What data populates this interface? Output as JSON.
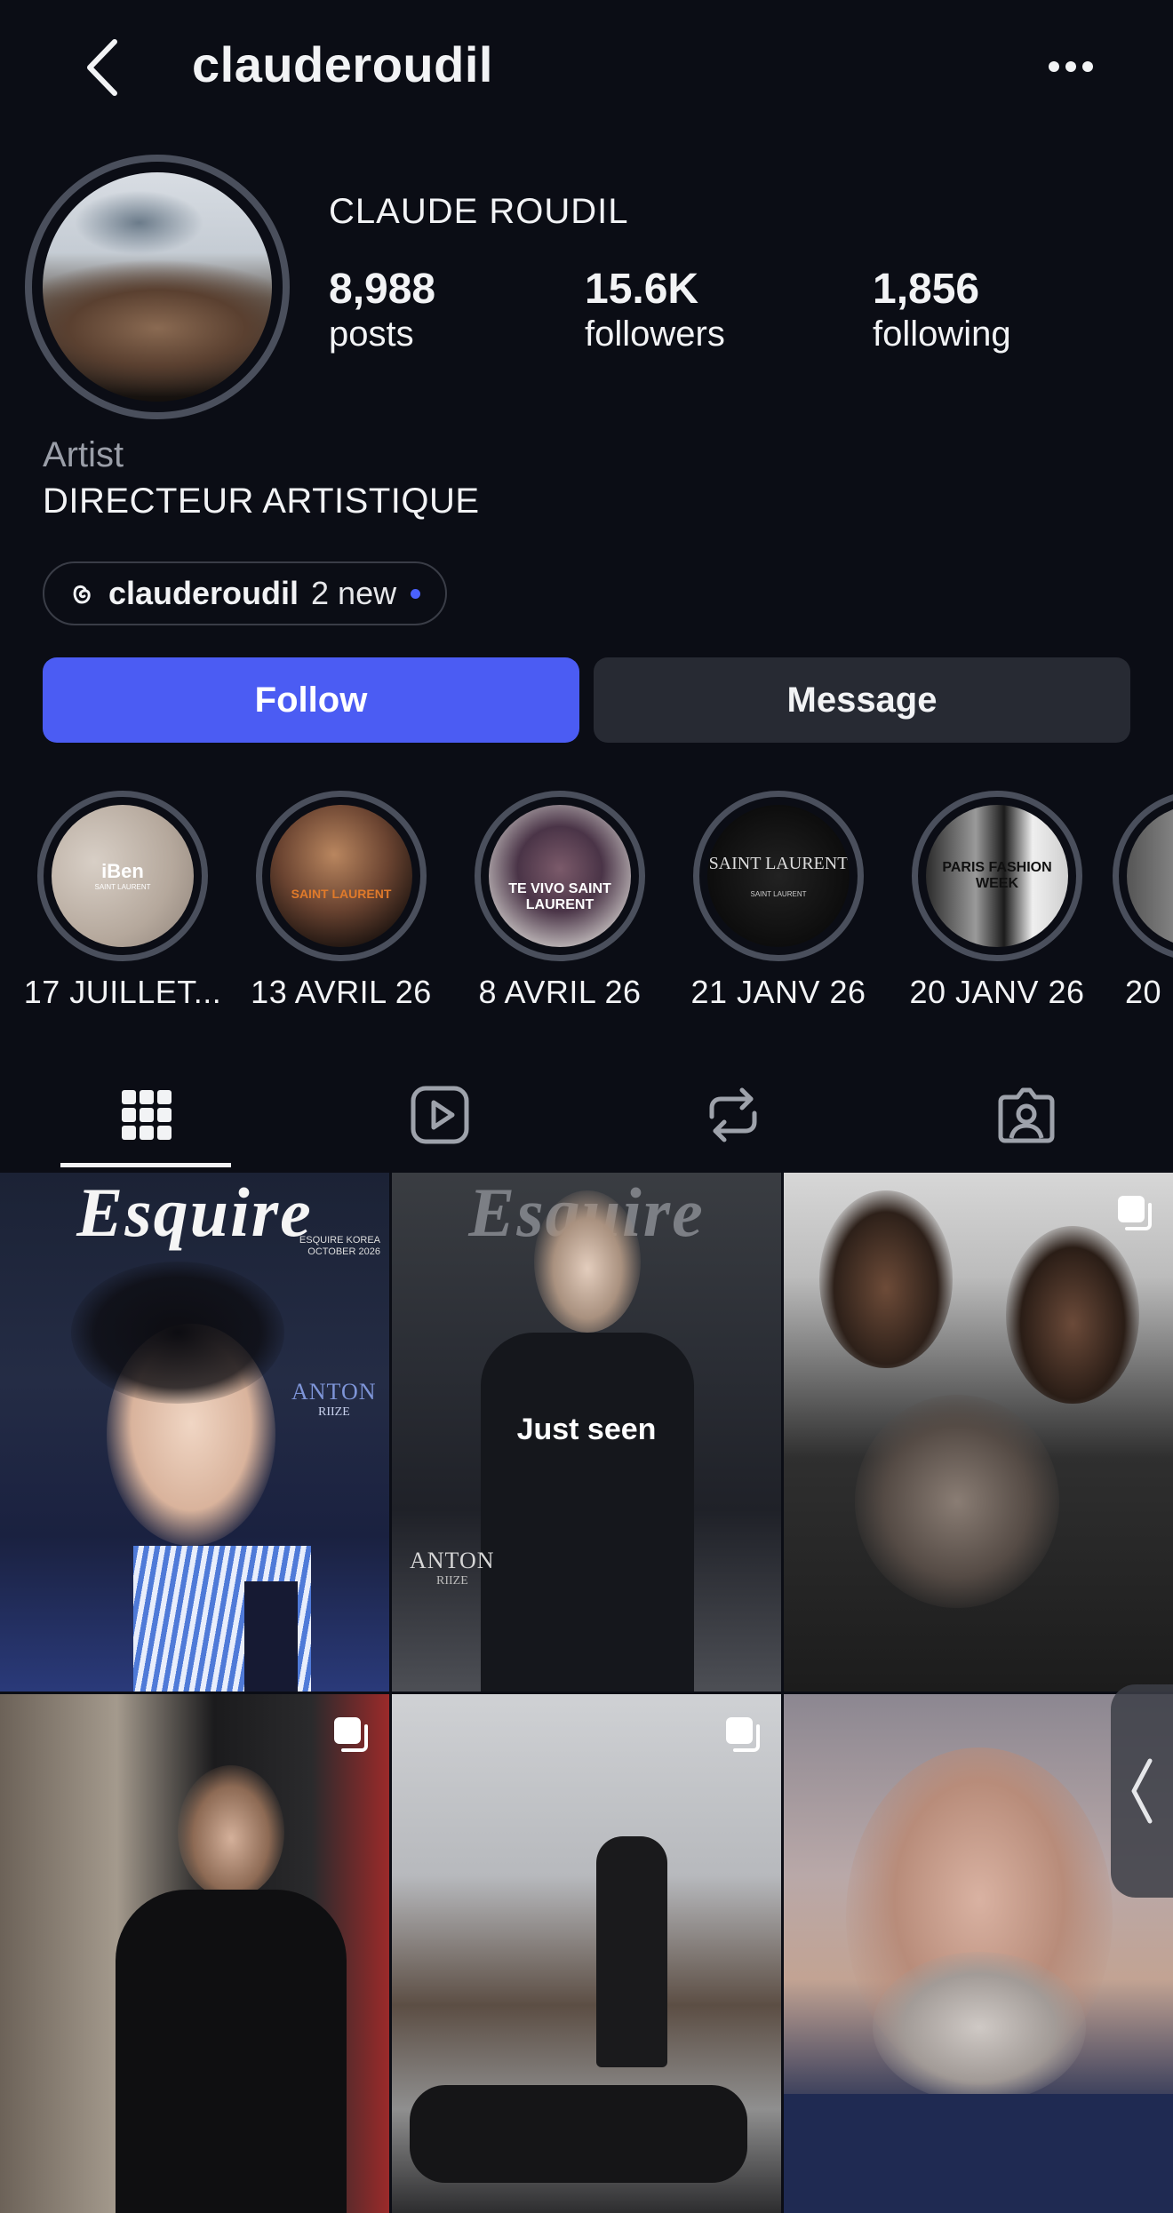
{
  "header": {
    "username": "clauderoudil",
    "back_icon": "chevron-left-icon",
    "more_icon": "more-horizontal-icon"
  },
  "profile": {
    "full_name": "CLAUDE ROUDIL",
    "stats": {
      "posts": {
        "value": "8,988",
        "label": "posts"
      },
      "followers": {
        "value": "15.6K",
        "label": "followers"
      },
      "following": {
        "value": "1,856",
        "label": "following"
      }
    },
    "category": "Artist",
    "bio": "DIRECTEUR ARTISTIQUE",
    "threads": {
      "handle": "clauderoudil",
      "new_label": "2 new",
      "icon": "threads-icon"
    }
  },
  "actions": {
    "follow_label": "Follow",
    "message_label": "Message",
    "follow_color": "#4b5cf3"
  },
  "highlights": [
    {
      "label": "17 JUILLET...",
      "cover_text": "iBen",
      "cover_sub": "SAINT LAURENT"
    },
    {
      "label": "13 AVRIL 26",
      "cover_text": "SAINT LAURENT"
    },
    {
      "label": "8 AVRIL 26",
      "cover_text": "TE VIVO SAINT LAURENT"
    },
    {
      "label": "21 JANV 26",
      "cover_text": "SAINT LAURENT",
      "cover_sub": "SAINT LAURENT"
    },
    {
      "label": "20 JANV 26",
      "cover_text": "PARIS FASHION WEEK"
    },
    {
      "label": "20"
    }
  ],
  "tabs": [
    {
      "name": "posts-grid",
      "icon": "grid-icon",
      "active": true
    },
    {
      "name": "reels",
      "icon": "reels-icon"
    },
    {
      "name": "reposts",
      "icon": "repost-icon"
    },
    {
      "name": "tagged",
      "icon": "tagged-user-icon"
    }
  ],
  "grid": {
    "posts": [
      {
        "magazine": "Esquire",
        "cover_name": "ANTON",
        "cover_sub": "RIIZE",
        "issue": "ESQUIRE KOREA",
        "issue_month": "OCTOBER 2026"
      },
      {
        "magazine": "Esquire",
        "cover_name": "ANTON",
        "cover_sub": "RIIZE",
        "overlay": "Just seen"
      },
      {
        "type": "carousel"
      },
      {
        "type": "carousel"
      },
      {
        "type": "carousel"
      },
      {
        "type": "video"
      }
    ]
  }
}
